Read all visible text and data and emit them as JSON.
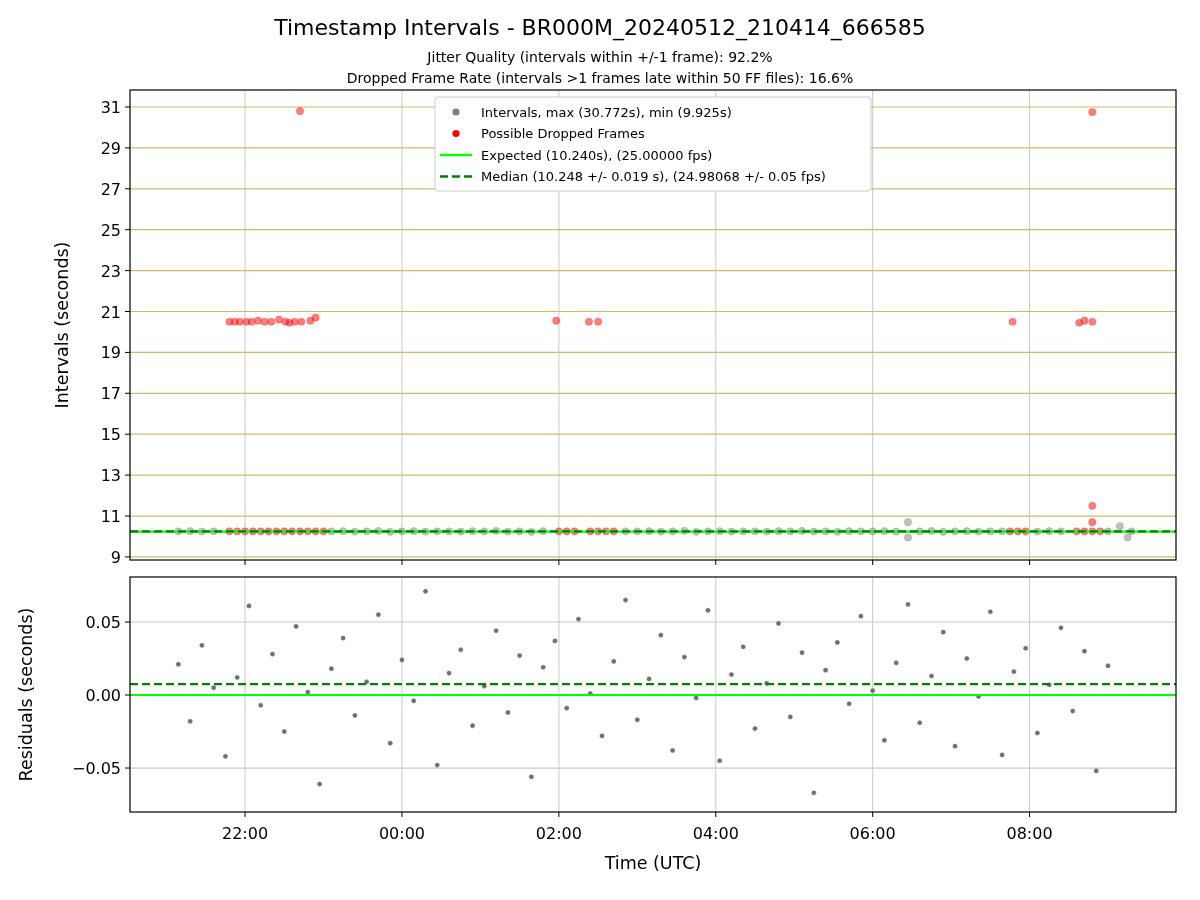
{
  "figure": {
    "title": "Timestamp Intervals - BR000M_20240512_210414_666585",
    "subtitles": [
      "Jitter Quality (intervals within +/-1 frame): 92.2%",
      "Dropped Frame Rate (intervals >1 frames late within 50 FF files): 16.6%"
    ]
  },
  "panels": [
    {
      "chart_data": {
        "type": "scatter",
        "ylabel": "Intervals (seconds)",
        "grid": true,
        "xlim": [
          "2024-05-12T20:32",
          "2024-05-13T09:52"
        ],
        "ylim": [
          8.85,
          31.83
        ],
        "yticks": [
          9,
          11,
          13,
          15,
          17,
          19,
          21,
          23,
          25,
          27,
          29,
          31
        ],
        "series": [
          {
            "name": "Intervals, max (30.772s), min (9.925s)",
            "color": "#808080",
            "x": [
              "2024-05-12T21:09",
              "2024-05-12T21:18",
              "2024-05-12T21:27",
              "2024-05-12T21:36",
              "2024-05-12T23:06",
              "2024-05-12T23:15",
              "2024-05-12T23:24",
              "2024-05-12T23:33",
              "2024-05-12T23:42",
              "2024-05-12T23:51",
              "2024-05-13T00:00",
              "2024-05-13T00:09",
              "2024-05-13T00:18",
              "2024-05-13T00:27",
              "2024-05-13T00:36",
              "2024-05-13T00:45",
              "2024-05-13T00:54",
              "2024-05-13T01:03",
              "2024-05-13T01:12",
              "2024-05-13T01:21",
              "2024-05-13T01:30",
              "2024-05-13T01:39",
              "2024-05-13T01:48",
              "2024-05-13T02:51",
              "2024-05-13T03:00",
              "2024-05-13T03:09",
              "2024-05-13T03:18",
              "2024-05-13T03:27",
              "2024-05-13T03:36",
              "2024-05-13T03:45",
              "2024-05-13T03:54",
              "2024-05-13T04:03",
              "2024-05-13T04:12",
              "2024-05-13T04:21",
              "2024-05-13T04:30",
              "2024-05-13T04:39",
              "2024-05-13T04:48",
              "2024-05-13T04:57",
              "2024-05-13T05:06",
              "2024-05-13T05:15",
              "2024-05-13T05:24",
              "2024-05-13T05:33",
              "2024-05-13T05:42",
              "2024-05-13T05:51",
              "2024-05-13T06:00",
              "2024-05-13T06:09",
              "2024-05-13T06:18",
              "2024-05-13T06:27",
              "2024-05-13T06:36",
              "2024-05-13T06:45",
              "2024-05-13T06:54",
              "2024-05-13T07:03",
              "2024-05-13T07:12",
              "2024-05-13T07:21",
              "2024-05-13T07:30",
              "2024-05-13T07:39",
              "2024-05-13T08:06",
              "2024-05-13T08:15",
              "2024-05-13T08:24",
              "2024-05-13T09:00",
              "2024-05-13T09:09",
              "2024-05-13T09:18",
              "2024-05-13T06:27",
              "2024-05-13T09:15"
            ],
            "values": [
              10.25,
              10.26,
              10.24,
              10.25,
              10.25,
              10.26,
              10.24,
              10.25,
              10.27,
              10.23,
              10.25,
              10.26,
              10.24,
              10.25,
              10.25,
              10.24,
              10.26,
              10.25,
              10.27,
              10.24,
              10.25,
              10.23,
              10.26,
              10.25,
              10.25,
              10.26,
              10.24,
              10.25,
              10.27,
              10.23,
              10.25,
              10.26,
              10.24,
              10.25,
              10.25,
              10.24,
              10.26,
              10.25,
              10.27,
              10.24,
              10.25,
              10.23,
              10.26,
              10.25,
              10.25,
              10.26,
              10.24,
              10.7,
              10.25,
              10.27,
              10.23,
              10.25,
              10.26,
              10.24,
              10.25,
              10.25,
              10.24,
              10.26,
              10.25,
              10.25,
              10.5,
              10.25,
              9.95,
              9.95
            ]
          },
          {
            "name": "Possible Dropped Frames",
            "color": "#ff0000",
            "x": [
              "2024-05-12T21:48",
              "2024-05-12T21:52",
              "2024-05-12T21:56",
              "2024-05-12T22:01",
              "2024-05-12T22:05",
              "2024-05-12T22:10",
              "2024-05-12T22:15",
              "2024-05-12T22:20",
              "2024-05-12T22:26",
              "2024-05-12T22:31",
              "2024-05-12T22:34",
              "2024-05-12T22:38",
              "2024-05-12T22:43",
              "2024-05-12T22:50",
              "2024-05-12T22:54",
              "2024-05-12T22:42",
              "2024-05-13T01:58",
              "2024-05-13T02:23",
              "2024-05-13T02:30",
              "2024-05-13T07:47",
              "2024-05-13T08:38",
              "2024-05-13T08:42",
              "2024-05-13T08:48",
              "2024-05-13T08:48",
              "2024-05-13T08:48",
              "2024-05-13T08:48",
              "2024-05-12T21:48",
              "2024-05-12T21:54",
              "2024-05-12T22:00",
              "2024-05-12T22:06",
              "2024-05-12T22:12",
              "2024-05-12T22:18",
              "2024-05-12T22:24",
              "2024-05-12T22:30",
              "2024-05-12T22:36",
              "2024-05-12T22:42",
              "2024-05-12T22:48",
              "2024-05-12T22:54",
              "2024-05-12T23:00",
              "2024-05-13T02:00",
              "2024-05-13T02:06",
              "2024-05-13T02:12",
              "2024-05-13T02:24",
              "2024-05-13T02:30",
              "2024-05-13T02:36",
              "2024-05-13T02:42",
              "2024-05-13T07:45",
              "2024-05-13T07:51",
              "2024-05-13T07:57",
              "2024-05-13T08:36",
              "2024-05-13T08:42",
              "2024-05-13T08:48",
              "2024-05-13T08:54"
            ],
            "values": [
              20.5,
              20.5,
              20.5,
              20.5,
              20.5,
              20.55,
              20.5,
              20.5,
              20.6,
              20.5,
              20.45,
              20.5,
              20.5,
              20.55,
              20.7,
              30.8,
              20.55,
              20.5,
              20.5,
              20.5,
              20.45,
              20.55,
              20.5,
              30.75,
              11.5,
              10.7,
              10.25,
              10.25,
              10.25,
              10.25,
              10.25,
              10.25,
              10.25,
              10.25,
              10.25,
              10.25,
              10.25,
              10.25,
              10.25,
              10.25,
              10.25,
              10.25,
              10.25,
              10.25,
              10.25,
              10.25,
              10.25,
              10.25,
              10.25,
              10.25,
              10.25,
              10.25,
              10.25
            ]
          }
        ],
        "ref_lines": [
          {
            "axis": "y",
            "value": 10.24,
            "label": "Expected (10.240s), (25.00000 fps)",
            "color": "#00ff00"
          },
          {
            "axis": "y",
            "value": 10.248,
            "label": "Median (10.248 +/- 0.019 s), (24.98068 +/- 0.05 fps)",
            "color": "#008000"
          }
        ],
        "legend": true
      }
    },
    {
      "chart_data": {
        "type": "scatter",
        "xlabel": "Time (UTC)",
        "ylabel": "Residuals (seconds)",
        "grid": true,
        "xlim": [
          "2024-05-12T20:32",
          "2024-05-13T09:52"
        ],
        "ylim": [
          -0.0801,
          0.0808
        ],
        "xticks": [
          {
            "value": "2024-05-12T22:00",
            "label": "22:00"
          },
          {
            "value": "2024-05-13T00:00",
            "label": "00:00"
          },
          {
            "value": "2024-05-13T02:00",
            "label": "02:00"
          },
          {
            "value": "2024-05-13T04:00",
            "label": "04:00"
          },
          {
            "value": "2024-05-13T06:00",
            "label": "06:00"
          },
          {
            "value": "2024-05-13T08:00",
            "label": "08:00"
          }
        ],
        "yticks": [
          {
            "value": -0.05,
            "label": "−0.05"
          },
          {
            "value": 0,
            "label": "0.00"
          },
          {
            "value": 0.05,
            "label": "0.05"
          }
        ],
        "series": [
          {
            "color": "#707070",
            "x": [
              "2024-05-12T21:09",
              "2024-05-12T21:18",
              "2024-05-12T21:27",
              "2024-05-12T21:36",
              "2024-05-12T21:45",
              "2024-05-12T21:54",
              "2024-05-12T22:03",
              "2024-05-12T22:12",
              "2024-05-12T22:21",
              "2024-05-12T22:30",
              "2024-05-12T22:39",
              "2024-05-12T22:48",
              "2024-05-12T22:57",
              "2024-05-12T23:06",
              "2024-05-12T23:15",
              "2024-05-12T23:24",
              "2024-05-12T23:33",
              "2024-05-12T23:42",
              "2024-05-12T23:51",
              "2024-05-13T00:00",
              "2024-05-13T00:09",
              "2024-05-13T00:18",
              "2024-05-13T00:27",
              "2024-05-13T00:36",
              "2024-05-13T00:45",
              "2024-05-13T00:54",
              "2024-05-13T01:03",
              "2024-05-13T01:12",
              "2024-05-13T01:21",
              "2024-05-13T01:30",
              "2024-05-13T01:39",
              "2024-05-13T01:48",
              "2024-05-13T01:57",
              "2024-05-13T02:06",
              "2024-05-13T02:15",
              "2024-05-13T02:24",
              "2024-05-13T02:33",
              "2024-05-13T02:42",
              "2024-05-13T02:51",
              "2024-05-13T03:00",
              "2024-05-13T03:09",
              "2024-05-13T03:18",
              "2024-05-13T03:27",
              "2024-05-13T03:36",
              "2024-05-13T03:45",
              "2024-05-13T03:54",
              "2024-05-13T04:03",
              "2024-05-13T04:12",
              "2024-05-13T04:21",
              "2024-05-13T04:30",
              "2024-05-13T04:39",
              "2024-05-13T04:48",
              "2024-05-13T04:57",
              "2024-05-13T05:06",
              "2024-05-13T05:15",
              "2024-05-13T05:24",
              "2024-05-13T05:33",
              "2024-05-13T05:42",
              "2024-05-13T05:51",
              "2024-05-13T06:00",
              "2024-05-13T06:09",
              "2024-05-13T06:18",
              "2024-05-13T06:27",
              "2024-05-13T06:36",
              "2024-05-13T06:45",
              "2024-05-13T06:54",
              "2024-05-13T07:03",
              "2024-05-13T07:12",
              "2024-05-13T07:21",
              "2024-05-13T07:30",
              "2024-05-13T07:39",
              "2024-05-13T07:48",
              "2024-05-13T07:57",
              "2024-05-13T08:06",
              "2024-05-13T08:15",
              "2024-05-13T08:24",
              "2024-05-13T08:33",
              "2024-05-13T08:42",
              "2024-05-13T08:51",
              "2024-05-13T09:00"
            ],
            "values": [
              0.021,
              -0.018,
              0.034,
              0.005,
              -0.042,
              0.012,
              0.061,
              -0.007,
              0.028,
              -0.025,
              0.047,
              0.002,
              -0.061,
              0.018,
              0.039,
              -0.014,
              0.009,
              0.055,
              -0.033,
              0.024,
              -0.004,
              0.071,
              -0.048,
              0.015,
              0.031,
              -0.021,
              0.006,
              0.044,
              -0.012,
              0.027,
              -0.056,
              0.019,
              0.037,
              -0.009,
              0.052,
              0.001,
              -0.028,
              0.023,
              0.065,
              -0.017,
              0.011,
              0.041,
              -0.038,
              0.026,
              -0.002,
              0.058,
              -0.045,
              0.014,
              0.033,
              -0.023,
              0.008,
              0.049,
              -0.015,
              0.029,
              -0.067,
              0.017,
              0.036,
              -0.006,
              0.054,
              0.003,
              -0.031,
              0.022,
              0.062,
              -0.019,
              0.013,
              0.043,
              -0.035,
              0.025,
              -0.001,
              0.057,
              -0.041,
              0.016,
              0.032,
              -0.026,
              0.007,
              0.046,
              -0.011,
              0.03,
              -0.052,
              0.02
            ]
          }
        ],
        "ref_lines": [
          {
            "axis": "y",
            "value": 0,
            "color": "#00ff00"
          },
          {
            "axis": "y",
            "value": 0.0075,
            "color": "#008000"
          }
        ]
      }
    }
  ]
}
